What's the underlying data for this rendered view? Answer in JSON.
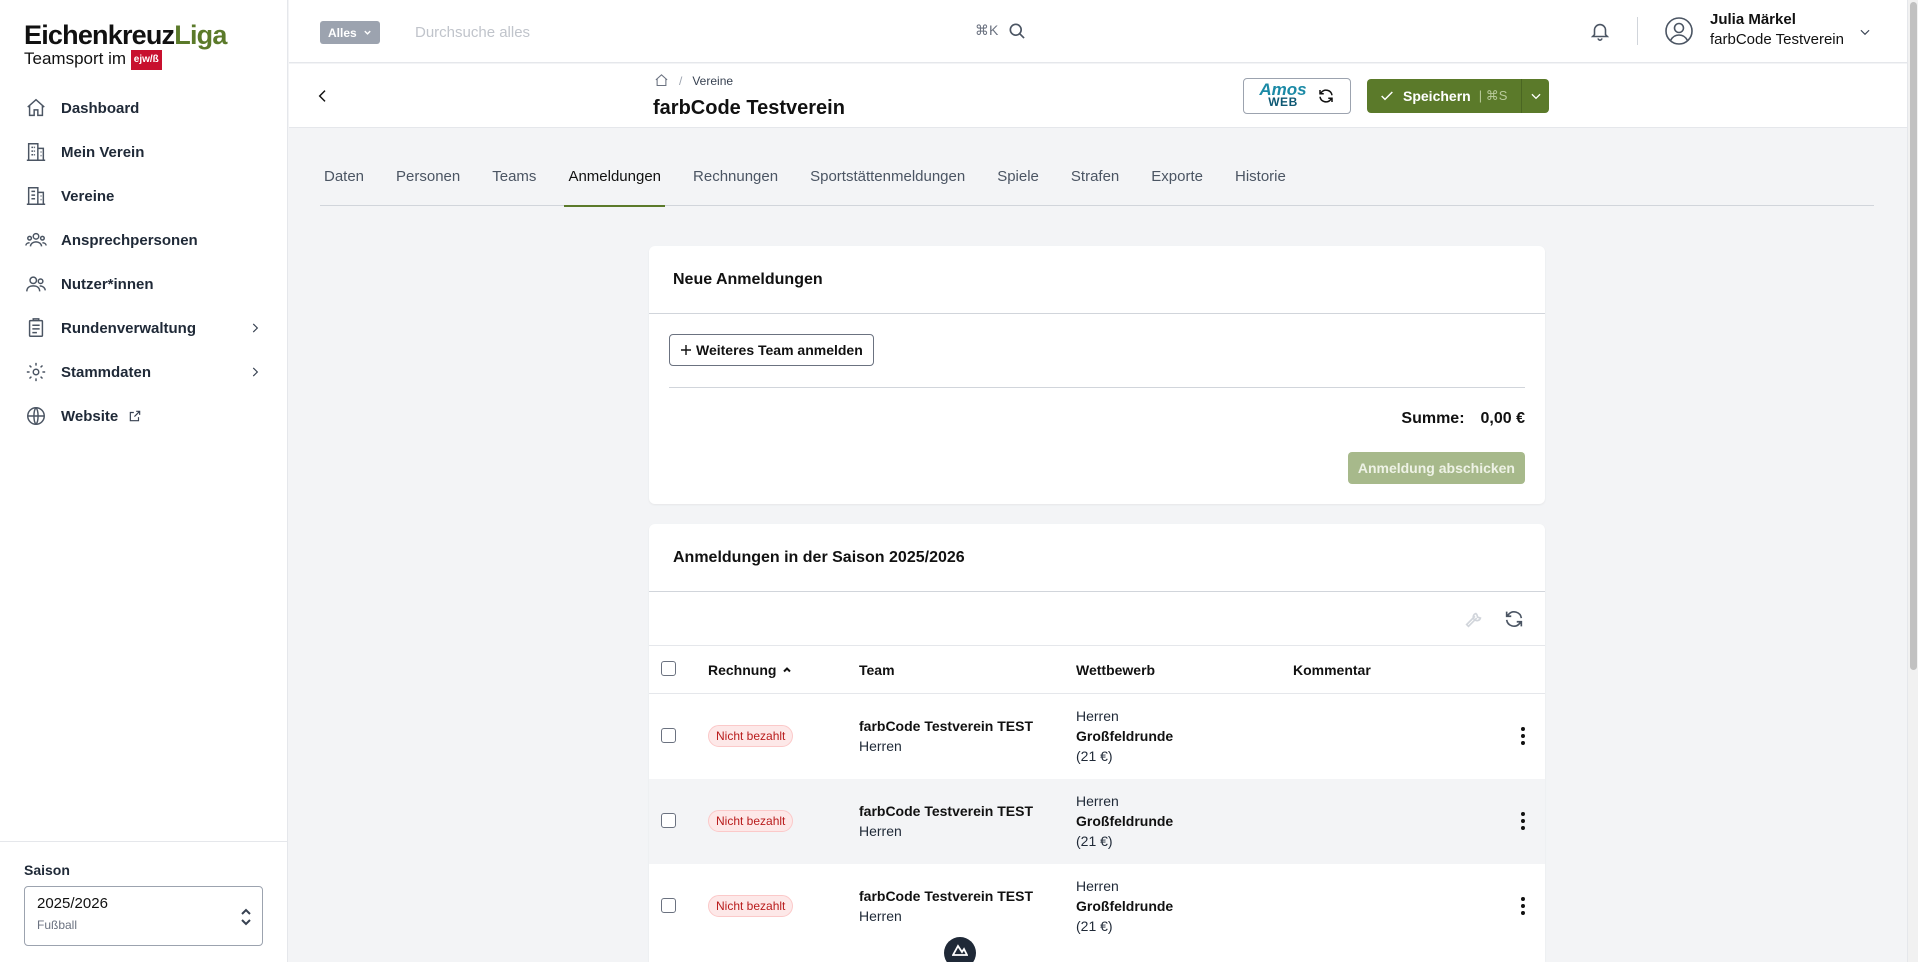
{
  "brand": {
    "name_dark": "Eichenkreuz",
    "name_accent": "Liga",
    "subtitle": "Teamsport im",
    "badge": "ejw/ß"
  },
  "sidebar": {
    "items": [
      {
        "label": "Dashboard",
        "icon": "home-icon"
      },
      {
        "label": "Mein Verein",
        "icon": "building-icon"
      },
      {
        "label": "Vereine",
        "icon": "buildings-icon"
      },
      {
        "label": "Ansprechpersonen",
        "icon": "users-icon"
      },
      {
        "label": "Nutzer*innen",
        "icon": "user-group-icon"
      },
      {
        "label": "Rundenverwaltung",
        "icon": "clipboard-icon",
        "has_children": true
      },
      {
        "label": "Stammdaten",
        "icon": "gear-icon",
        "has_children": true
      },
      {
        "label": "Website",
        "icon": "globe-icon",
        "external": true
      }
    ],
    "saison": {
      "label": "Saison",
      "value": "2025/2026",
      "sub": "Fußball"
    }
  },
  "topbar": {
    "scope": "Alles",
    "search_placeholder": "Durchsuche alles",
    "shortcut": "⌘K",
    "user_name": "Julia Märkel",
    "user_org": "farbCode Testverein"
  },
  "header": {
    "breadcrumb": "Vereine",
    "title": "farbCode Testverein",
    "amos_top": "Amos",
    "amos_bottom": "WEB",
    "save_label": "Speichern",
    "save_kbd": "| ⌘S"
  },
  "tabs": [
    "Daten",
    "Personen",
    "Teams",
    "Anmeldungen",
    "Rechnungen",
    "Sportstättenmeldungen",
    "Spiele",
    "Strafen",
    "Exporte",
    "Historie"
  ],
  "active_tab": "Anmeldungen",
  "neue": {
    "title": "Neue Anmeldungen",
    "add_button": "Weiteres Team anmelden",
    "sum_label": "Summe:",
    "sum_value": "0,00 €",
    "submit": "Anmeldung abschicken"
  },
  "saison_list": {
    "title": "Anmeldungen in der Saison 2025/2026",
    "columns": {
      "rechnung": "Rechnung",
      "team": "Team",
      "wettbewerb": "Wettbewerb",
      "kommentar": "Kommentar"
    },
    "rows": [
      {
        "status": "Nicht bezahlt",
        "team": "farbCode Testverein TEST",
        "team_sub": "Herren",
        "comp_1": "Herren",
        "comp_2": "Großfeldrunde",
        "comp_3": "(21 €)"
      },
      {
        "status": "Nicht bezahlt",
        "team": "farbCode Testverein TEST",
        "team_sub": "Herren",
        "comp_1": "Herren",
        "comp_2": "Großfeldrunde",
        "comp_3": "(21 €)"
      },
      {
        "status": "Nicht bezahlt",
        "team": "farbCode Testverein TEST",
        "team_sub": "Herren",
        "comp_1": "Herren",
        "comp_2": "Großfeldrunde",
        "comp_3": "(21 €)"
      }
    ]
  },
  "colors": {
    "accent": "#5b7a2a",
    "danger": "#b91c1c"
  }
}
